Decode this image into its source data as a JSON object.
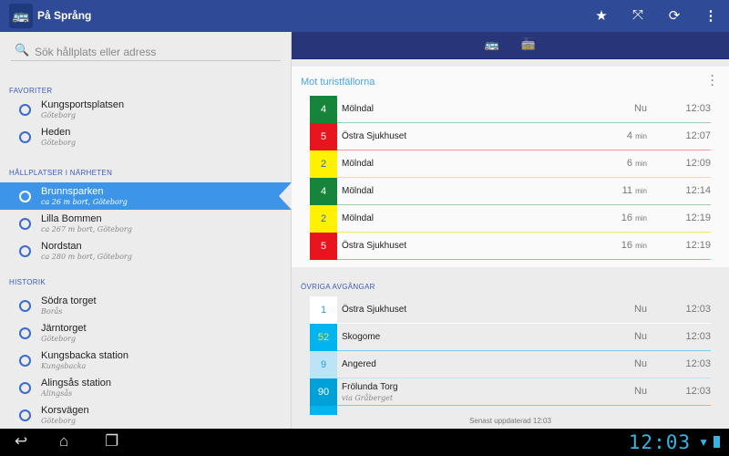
{
  "app": {
    "title": "På Språng",
    "logo": "bus-logo-icon",
    "actions": [
      "star-icon",
      "map-pins-icon",
      "refresh-icon",
      "overflow-menu-icon"
    ]
  },
  "search": {
    "placeholder": "Sök hållplats eller adress"
  },
  "sections": {
    "favorites": "FAVORITER",
    "nearby": "HÅLLPLATSER I NÄRHETEN",
    "history": "HISTORIK"
  },
  "favorites": [
    {
      "name": "Kungsportsplatsen",
      "sub": "Göteborg"
    },
    {
      "name": "Heden",
      "sub": "Göteborg"
    }
  ],
  "nearby": [
    {
      "name": "Brunnsparken",
      "sub": "ca 26 m bort, Göteborg",
      "selected": true
    },
    {
      "name": "Lilla Bommen",
      "sub": "ca 267 m bort, Göteborg"
    },
    {
      "name": "Nordstan",
      "sub": "ca 280 m bort, Göteborg"
    }
  ],
  "history": [
    {
      "name": "Södra torget",
      "sub": "Borås"
    },
    {
      "name": "Järntorget",
      "sub": "Göteborg"
    },
    {
      "name": "Kungsbacka station",
      "sub": "Kungsbacka"
    },
    {
      "name": "Alingsås station",
      "sub": "Alingsås"
    },
    {
      "name": "Korsvägen",
      "sub": "Göteborg"
    }
  ],
  "tabs": [
    "bus-icon",
    "tram-icon"
  ],
  "card": {
    "title": "Mot turistfällorna",
    "departures": [
      {
        "line": "4",
        "dest": "Mölndal",
        "mins": "Nu",
        "unit": "",
        "time": "12:03",
        "bg": "#17843b",
        "fg": "#ffffff",
        "lc": "#9ccfa9"
      },
      {
        "line": "5",
        "dest": "Östra Sjukhuset",
        "mins": "4",
        "unit": "min",
        "time": "12:07",
        "bg": "#e8141e",
        "fg": "#ffffff",
        "lc": "#f19a9c"
      },
      {
        "line": "2",
        "dest": "Mölndal",
        "mins": "6",
        "unit": "min",
        "time": "12:09",
        "bg": "#fff200",
        "fg": "#2a6cc4",
        "lc": "#f3ea5a"
      },
      {
        "line": "4",
        "dest": "Mölndal",
        "mins": "11",
        "unit": "min",
        "time": "12:14",
        "bg": "#17843b",
        "fg": "#ffffff",
        "lc": "#9ccfa9"
      },
      {
        "line": "2",
        "dest": "Mölndal",
        "mins": "16",
        "unit": "min",
        "time": "12:19",
        "bg": "#fff200",
        "fg": "#2a6cc4",
        "lc": "#f3ea5a"
      },
      {
        "line": "5",
        "dest": "Östra Sjukhuset",
        "mins": "16",
        "unit": "min",
        "time": "12:19",
        "bg": "#e8141e",
        "fg": "#ffffff",
        "lc": "#f19a9c"
      }
    ]
  },
  "other": {
    "title": "ÖVRIGA AVGÅNGAR",
    "departures": [
      {
        "line": "1",
        "dest": "Östra Sjukhuset",
        "via": "",
        "mins": "Nu",
        "time": "12:03",
        "bg": "#ffffff",
        "fg": "#2b9ee0",
        "lc": "#ffffff"
      },
      {
        "line": "52",
        "dest": "Skogome",
        "via": "",
        "mins": "Nu",
        "time": "12:03",
        "bg": "#00b4ef",
        "fg": "#e8e84a",
        "lc": "#7ec9ee"
      },
      {
        "line": "9",
        "dest": "Angered",
        "via": "",
        "mins": "Nu",
        "time": "12:03",
        "bg": "#bde3f7",
        "fg": "#2b9ee0",
        "lc": "#bde3f7"
      },
      {
        "line": "90",
        "dest": "Frölunda Torg",
        "via": "via Gråberget",
        "mins": "Nu",
        "time": "12:03",
        "bg": "#00a0d8",
        "fg": "#ffffff",
        "lc": "#7ec9ee"
      }
    ],
    "updated": "Senast uppdaterad 12:03"
  },
  "status": {
    "clock": "12:03"
  }
}
